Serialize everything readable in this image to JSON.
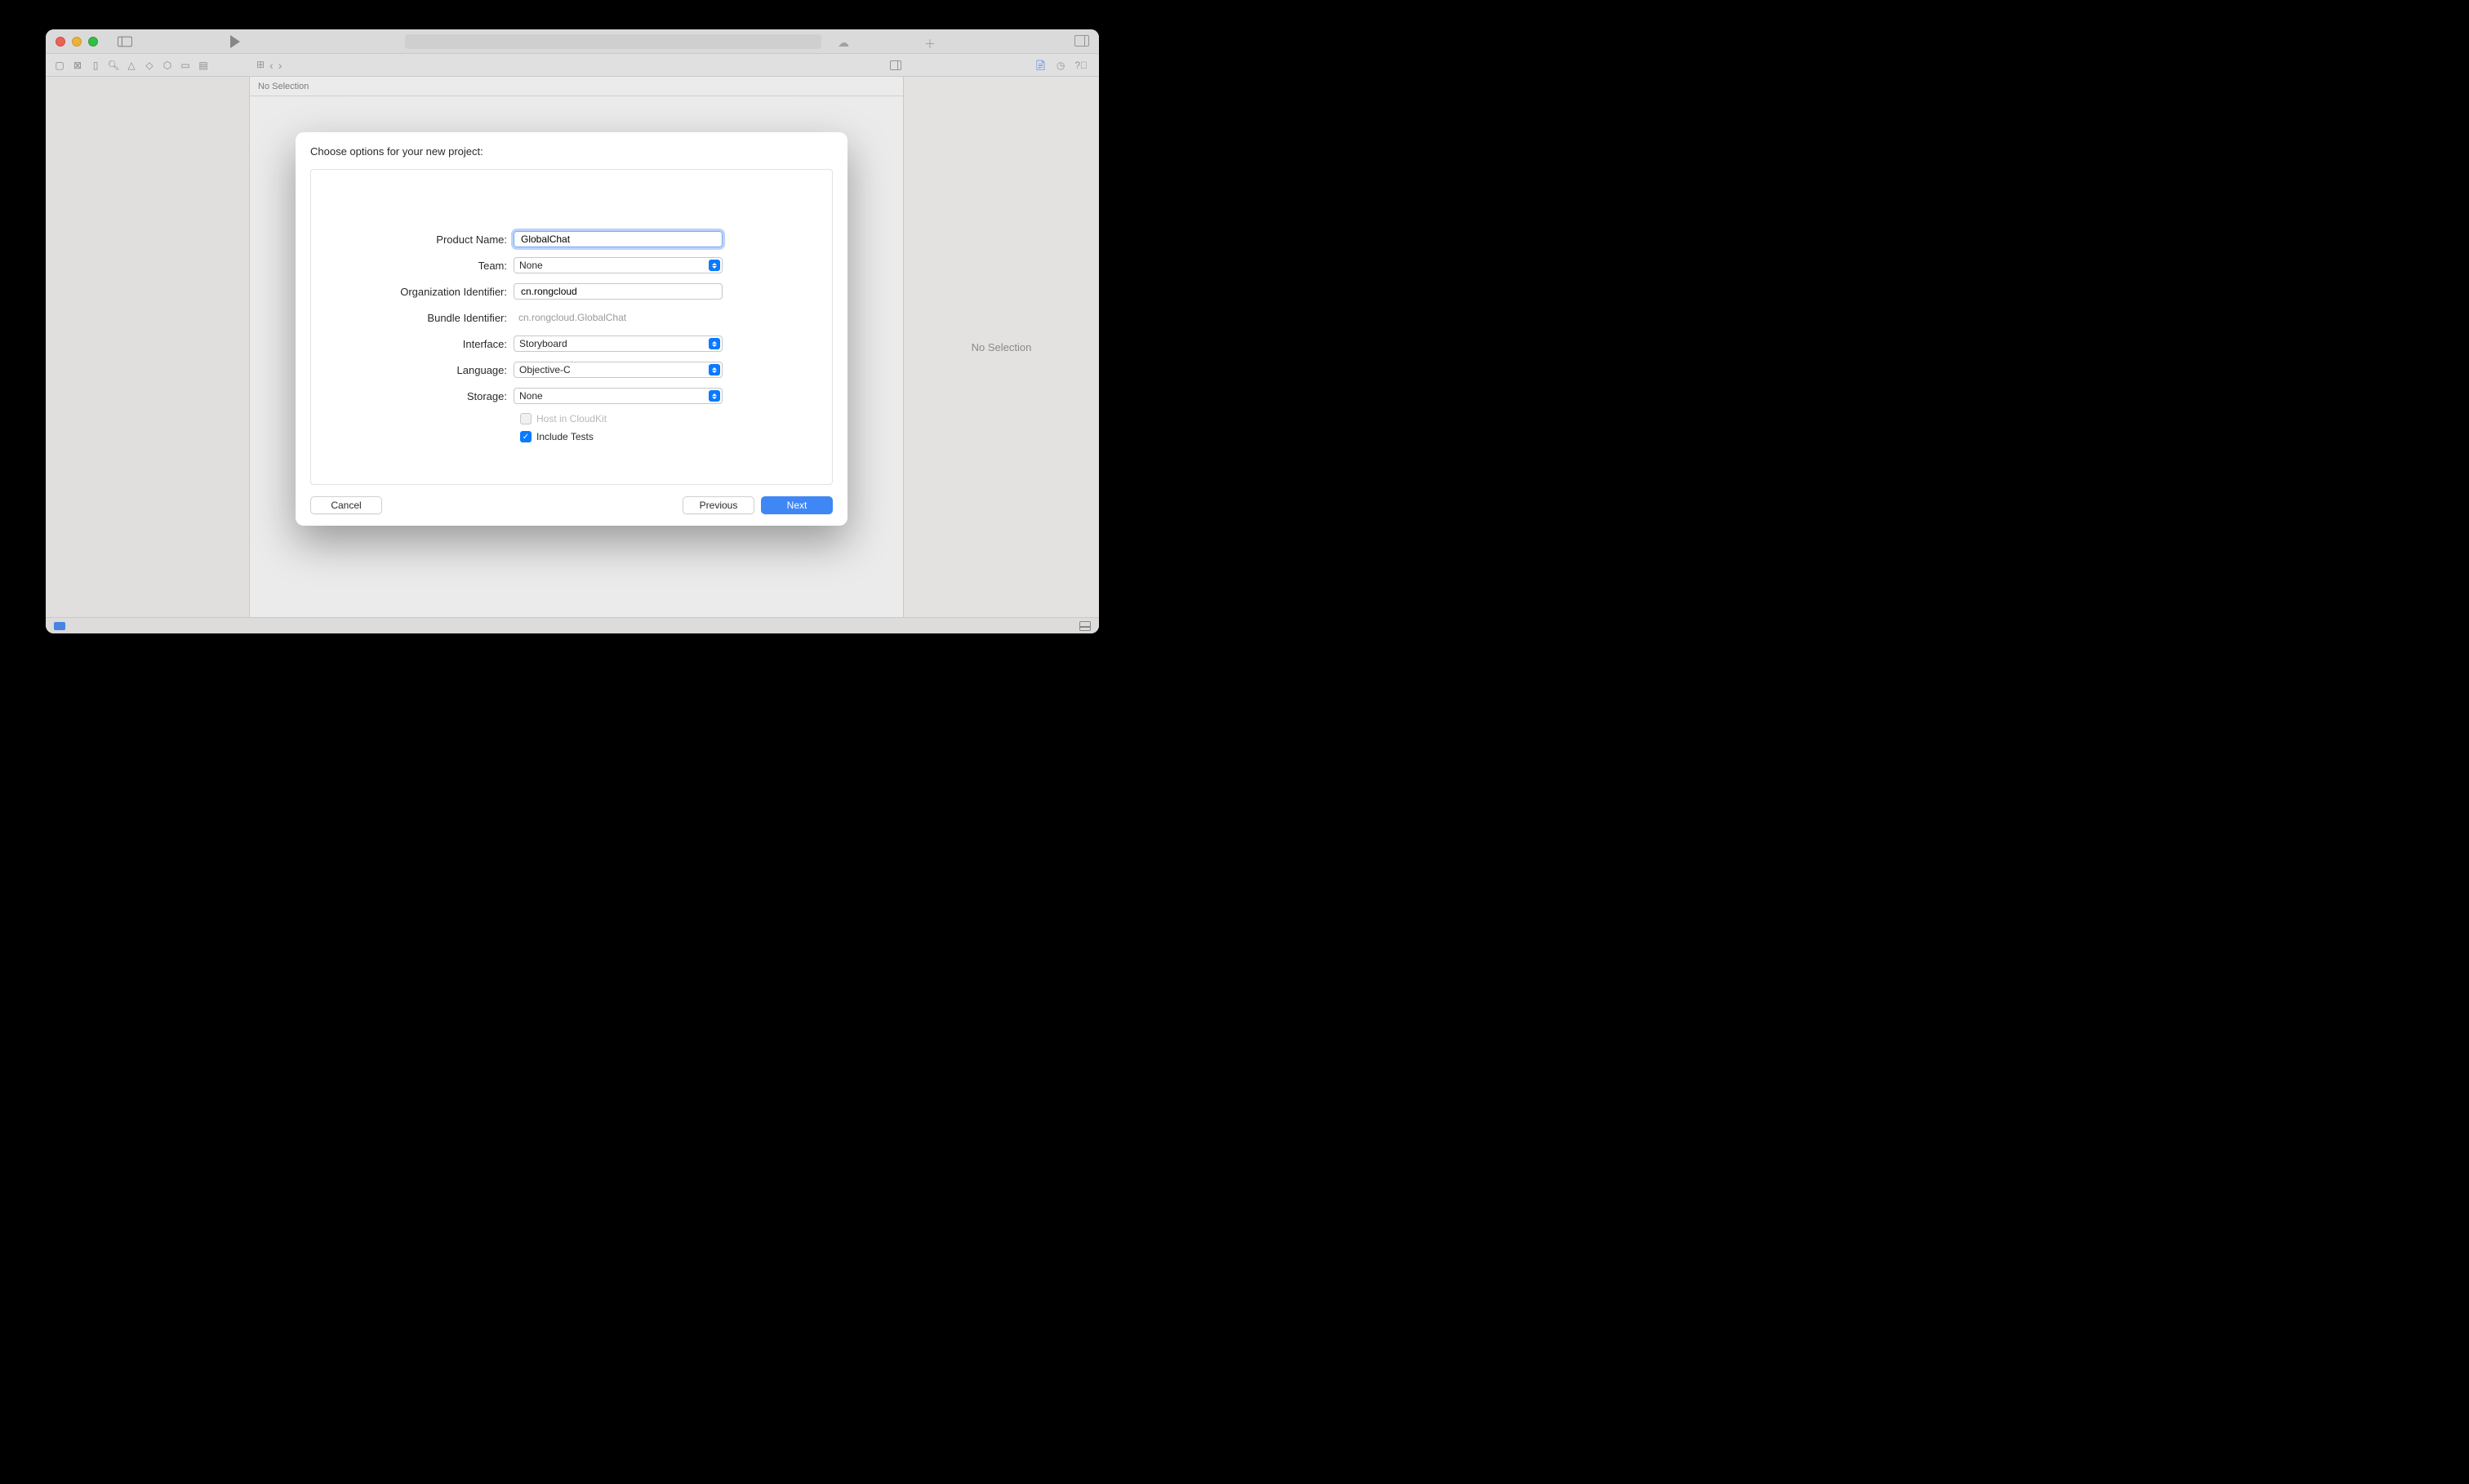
{
  "editor": {
    "no_selection_header": "No Selection"
  },
  "inspector": {
    "empty_text": "No Selection"
  },
  "sheet": {
    "title": "Choose options for your new project:",
    "labels": {
      "product_name": "Product Name:",
      "team": "Team:",
      "org_id": "Organization Identifier:",
      "bundle_id": "Bundle Identifier:",
      "interface": "Interface:",
      "language": "Language:",
      "storage": "Storage:"
    },
    "values": {
      "product_name": "GlobalChat",
      "team": "None",
      "org_id": "cn.rongcloud",
      "bundle_id": "cn.rongcloud.GlobalChat",
      "interface": "Storyboard",
      "language": "Objective-C",
      "storage": "None"
    },
    "checkboxes": {
      "cloudkit": "Host in CloudKit",
      "tests": "Include Tests"
    },
    "buttons": {
      "cancel": "Cancel",
      "previous": "Previous",
      "next": "Next"
    }
  }
}
